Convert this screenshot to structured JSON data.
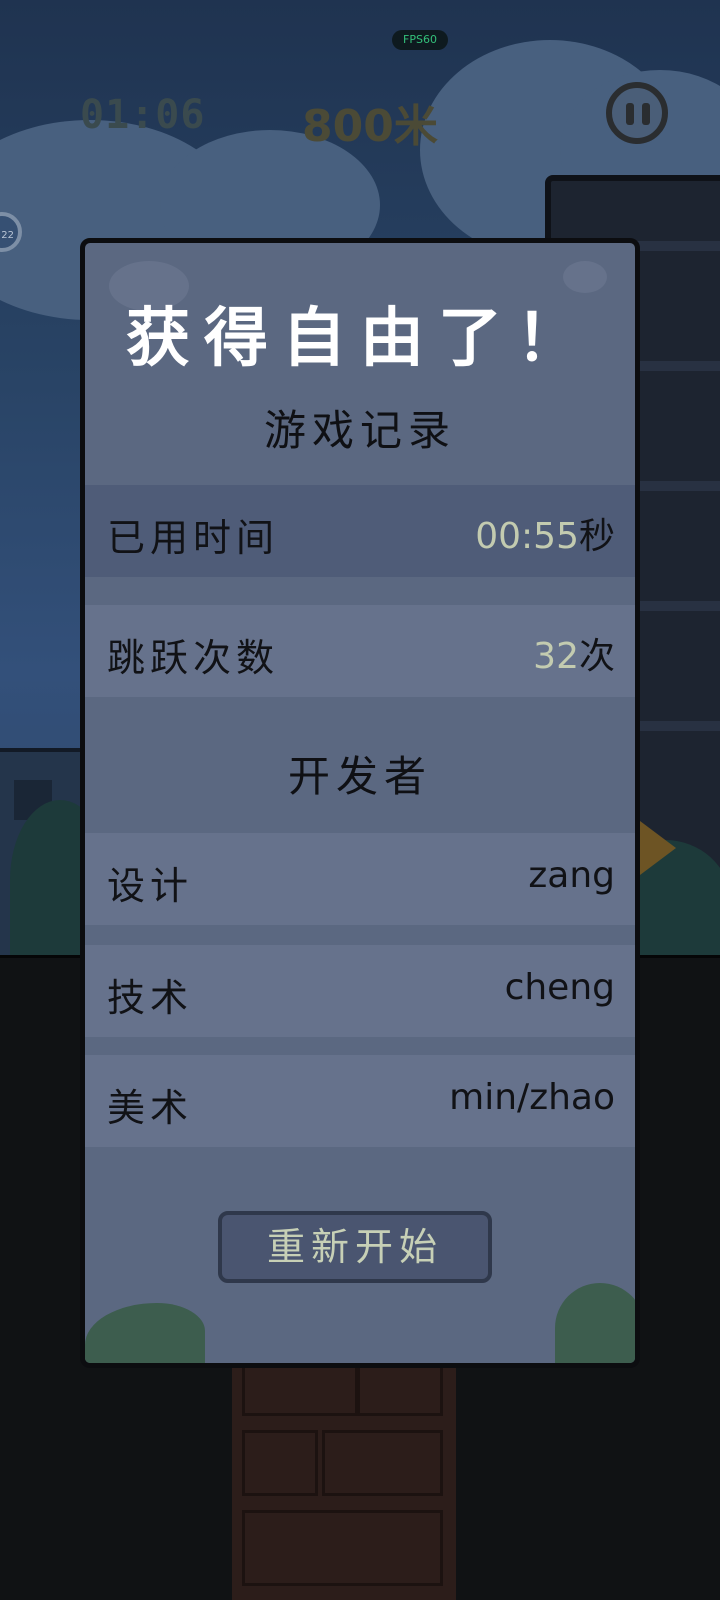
{
  "hud": {
    "fps": "FPS60",
    "time": "01:06",
    "distance": "800米",
    "side_badge": "22"
  },
  "dialog": {
    "title": "获得自由了！",
    "record_section": "游戏记录",
    "stats": [
      {
        "label": "已用时间",
        "value": "00:55",
        "unit": "秒"
      },
      {
        "label": "跳跃次数",
        "value": "32",
        "unit": "次"
      }
    ],
    "credits_section": "开发者",
    "credits": [
      {
        "label": "设计",
        "value": "zang"
      },
      {
        "label": "技术",
        "value": "cheng"
      },
      {
        "label": "美术",
        "value": "min/zhao"
      }
    ],
    "restart_label": "重新开始"
  },
  "colors": {
    "dialog_bg": "#5b6881",
    "row_dark": "#4f5c78",
    "row_light": "#66728c",
    "title_text": "#ffffff",
    "value_number": "#c3cbb0",
    "button_bg": "#4a5570"
  }
}
